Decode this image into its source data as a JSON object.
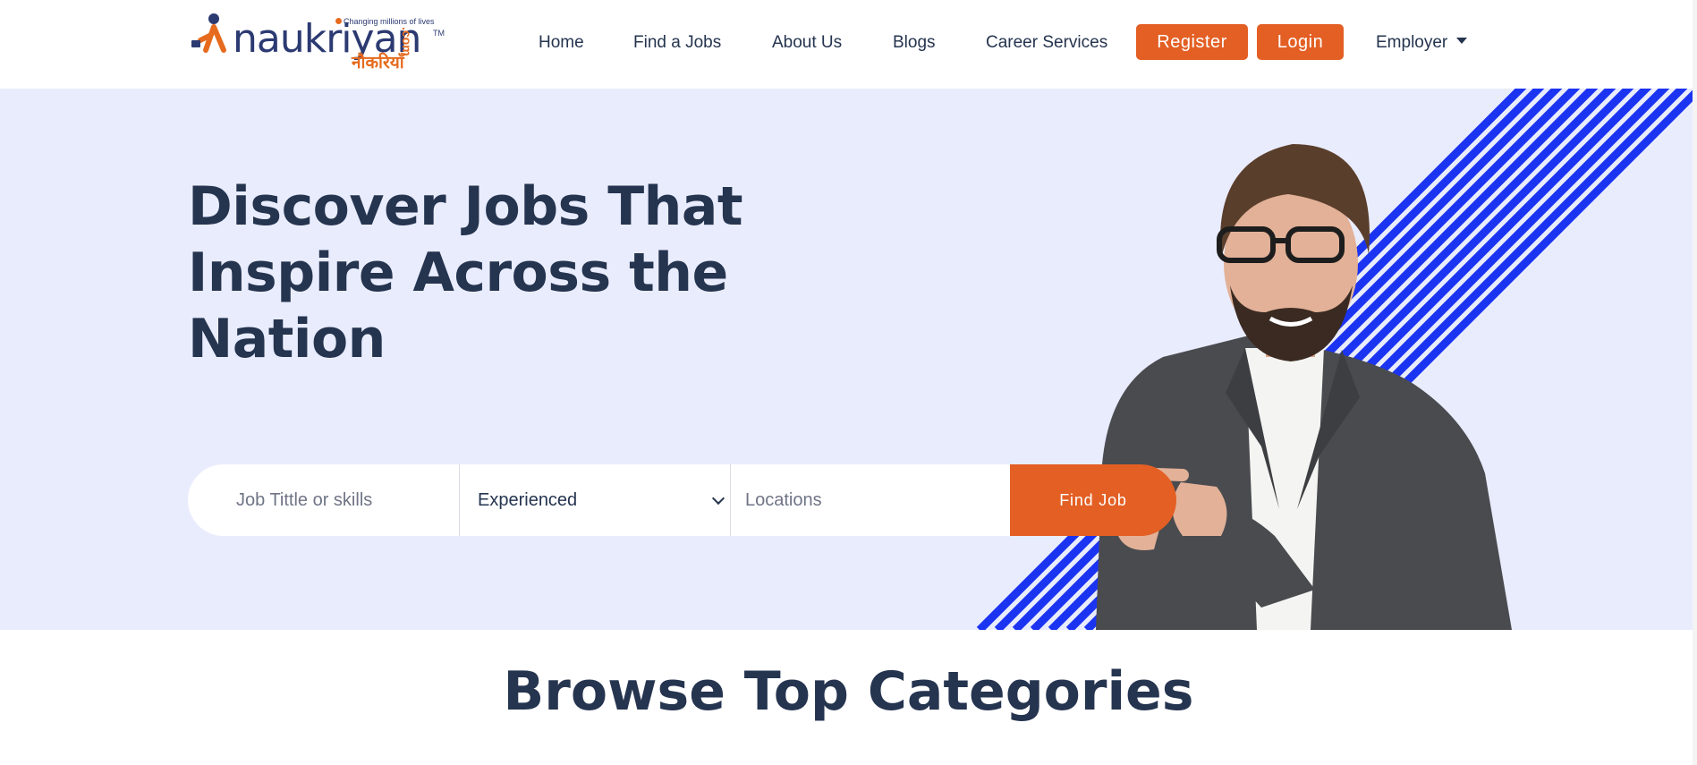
{
  "brand": {
    "logo_text": "naukriyan",
    "tagline": "Changing millions of lives",
    "hindi_name": "नौकरियाँ",
    "suffix": ".com",
    "tm": "TM",
    "colors": {
      "navy": "#2c3a72",
      "orange": "#e66b1e"
    }
  },
  "nav": {
    "items": [
      {
        "label": "Home"
      },
      {
        "label": "Find a Jobs"
      },
      {
        "label": "About Us"
      },
      {
        "label": "Blogs"
      },
      {
        "label": "Career Services"
      }
    ],
    "register_label": "Register",
    "login_label": "Login",
    "employer_label": "Employer"
  },
  "hero": {
    "title": "Discover Jobs That Inspire Across the Nation",
    "background": "#e9ecfd",
    "stripe_color": "#1b34f2",
    "search": {
      "job_placeholder": "Job Tittle or skills",
      "experience_selected": "Experienced",
      "location_placeholder": "Locations",
      "button_label": "Find Job"
    }
  },
  "browse": {
    "title": "Browse Top Categories"
  },
  "theme": {
    "accent": "#e35f24",
    "text": "#25344f"
  }
}
